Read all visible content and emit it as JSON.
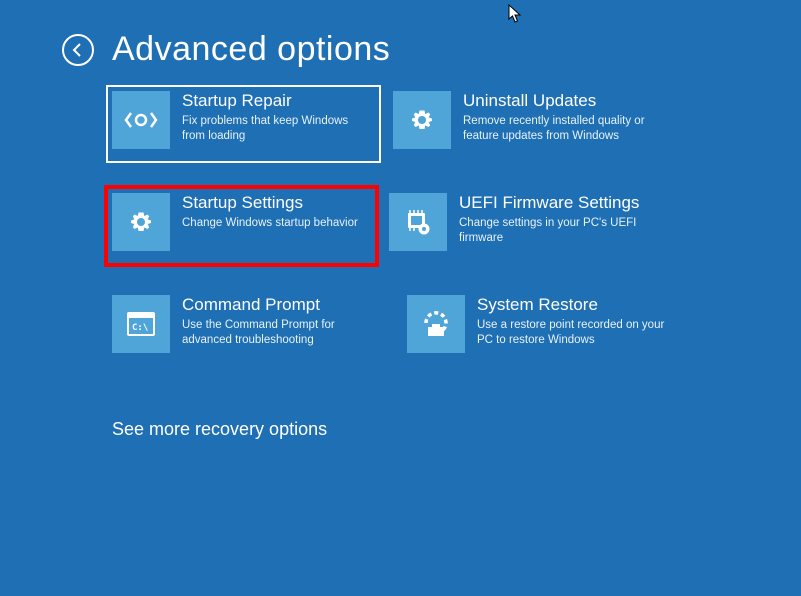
{
  "header": {
    "title": "Advanced options"
  },
  "tiles": {
    "startup_repair": {
      "title": "Startup Repair",
      "desc": "Fix problems that keep Windows from loading"
    },
    "uninstall_updates": {
      "title": "Uninstall Updates",
      "desc": "Remove recently installed quality or feature updates from Windows"
    },
    "startup_settings": {
      "title": "Startup Settings",
      "desc": "Change Windows startup behavior"
    },
    "uefi": {
      "title": "UEFI Firmware Settings",
      "desc": "Change settings in your PC's UEFI firmware"
    },
    "command_prompt": {
      "title": "Command Prompt",
      "desc": "Use the Command Prompt for advanced troubleshooting"
    },
    "system_restore": {
      "title": "System Restore",
      "desc": "Use a restore point recorded on your PC to restore Windows"
    }
  },
  "more_link": "See more recovery options"
}
